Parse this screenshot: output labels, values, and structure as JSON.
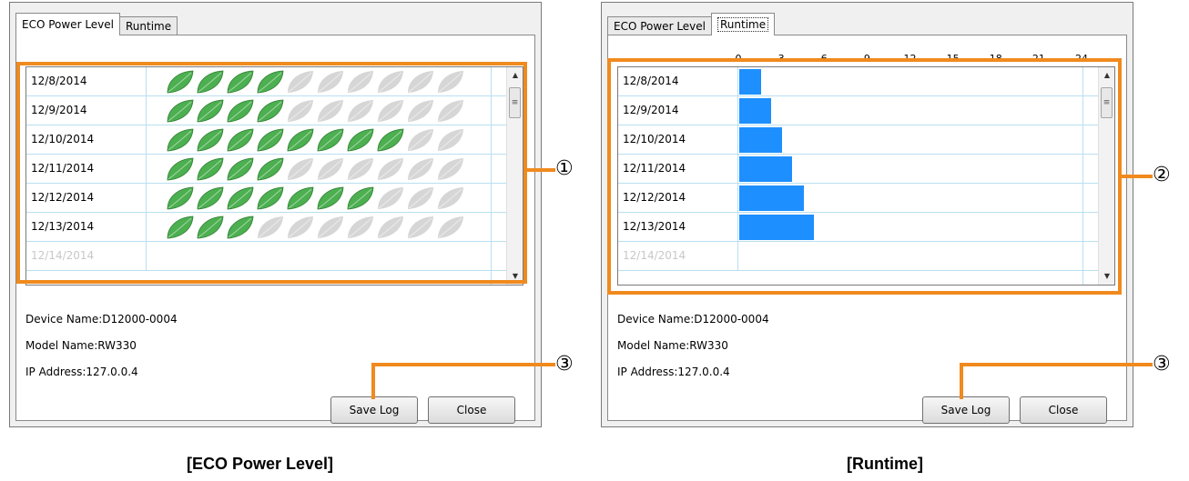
{
  "eco_window": {
    "tabs": [
      {
        "label": "ECO Power Level"
      },
      {
        "label": "Runtime"
      }
    ],
    "rows": [
      {
        "date": "12/8/2014",
        "leaves": 4
      },
      {
        "date": "12/9/2014",
        "leaves": 4
      },
      {
        "date": "12/10/2014",
        "leaves": 8
      },
      {
        "date": "12/11/2014",
        "leaves": 4
      },
      {
        "date": "12/12/2014",
        "leaves": 7
      },
      {
        "date": "12/13/2014",
        "leaves": 3
      },
      {
        "date": "12/14/2014",
        "leaves": 0
      }
    ],
    "max_leaves": 10,
    "info": {
      "device": "Device Name:D12000-0004",
      "model": "Model Name:RW330",
      "ip": "IP Address:127.0.0.4"
    },
    "buttons": {
      "save": "Save Log",
      "close": "Close"
    },
    "caption": "[ECO Power Level]"
  },
  "runtime_window": {
    "tabs": [
      {
        "label": "ECO Power Level"
      },
      {
        "label": "Runtime"
      }
    ],
    "axis_ticks": [
      "0",
      "3",
      "6",
      "9",
      "12",
      "15",
      "18",
      "21",
      "24"
    ],
    "axis_max": 24,
    "rows": [
      {
        "date": "12/8/2014",
        "hours": 1.5
      },
      {
        "date": "12/9/2014",
        "hours": 2.2
      },
      {
        "date": "12/10/2014",
        "hours": 3
      },
      {
        "date": "12/11/2014",
        "hours": 3.7
      },
      {
        "date": "12/12/2014",
        "hours": 4.5
      },
      {
        "date": "12/13/2014",
        "hours": 5.2
      },
      {
        "date": "12/14/2014",
        "hours": 0
      }
    ],
    "info": {
      "device": "Device Name:D12000-0004",
      "model": "Model Name:RW330",
      "ip": "IP Address:127.0.0.4"
    },
    "buttons": {
      "save": "Save Log",
      "close": "Close"
    },
    "caption": "[Runtime]"
  },
  "callouts": [
    "①",
    "②",
    "③",
    "③"
  ],
  "colors": {
    "callout": "#f08a1e",
    "leaf_on": "#4caf50",
    "leaf_off": "#d6d6d6",
    "bar": "#1e8fff",
    "grid_line": "#b9dff0"
  }
}
